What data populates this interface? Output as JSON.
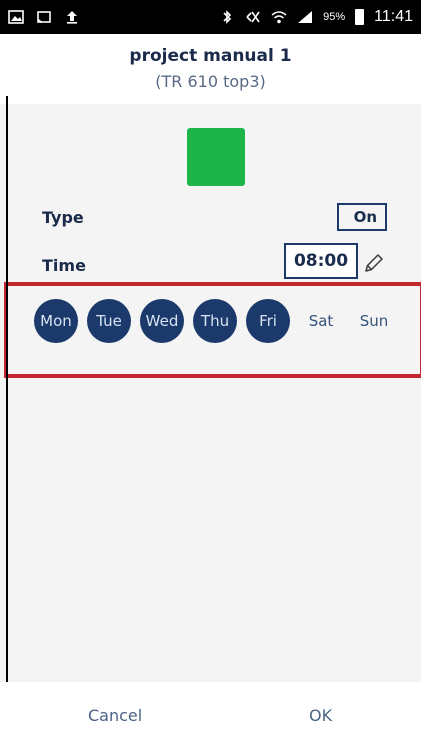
{
  "status_bar": {
    "battery_percent": "95%",
    "time": "11:41",
    "icons": [
      "image-icon",
      "cast-icon",
      "upload-icon",
      "bluetooth-icon",
      "mute-icon",
      "wifi-icon",
      "signal-icon",
      "battery-icon"
    ]
  },
  "header": {
    "title": "project manual 1",
    "subtitle": "(TR 610 top3)"
  },
  "swatch": {
    "color": "#1db54a"
  },
  "type": {
    "label": "Type",
    "value": "On"
  },
  "time": {
    "label": "Time",
    "value": "08:00"
  },
  "days": [
    {
      "label": "Mon",
      "active": true
    },
    {
      "label": "Tue",
      "active": true
    },
    {
      "label": "Wed",
      "active": true
    },
    {
      "label": "Thu",
      "active": true
    },
    {
      "label": "Fri",
      "active": true
    },
    {
      "label": "Sat",
      "active": false
    },
    {
      "label": "Sun",
      "active": false
    }
  ],
  "footer": {
    "cancel": "Cancel",
    "ok": "OK"
  },
  "colors": {
    "accent": "#1b3a6b",
    "highlight": "#c1272d"
  }
}
